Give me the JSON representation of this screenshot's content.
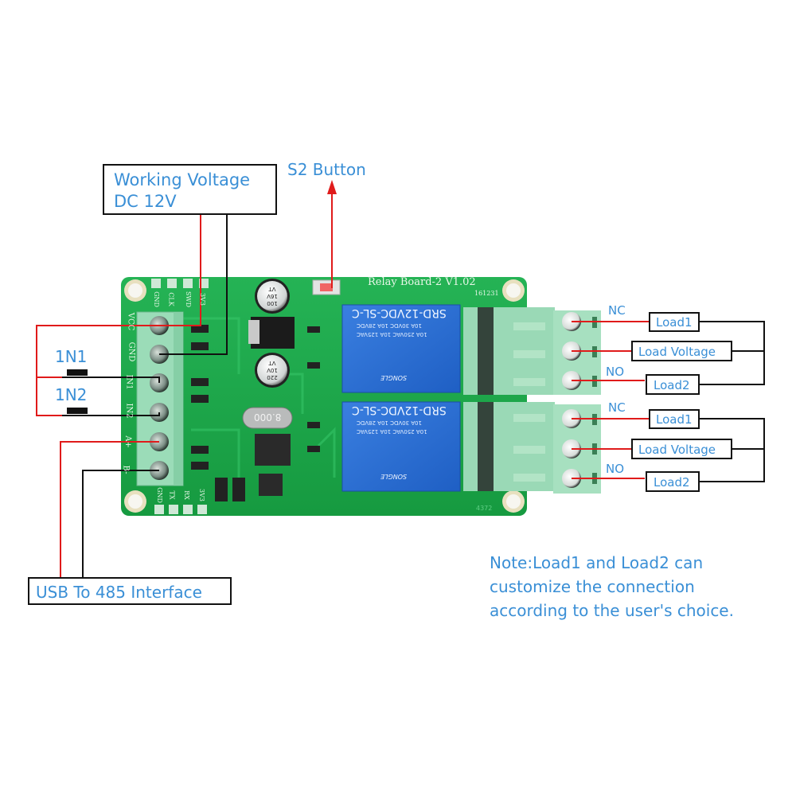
{
  "diagram": {
    "title_box": {
      "line1": "Working Voltage",
      "line2": "DC 12V"
    },
    "s2_label": "S2 Button",
    "inputs": {
      "in1": "1N1",
      "in2": "1N2"
    },
    "usb_box": "USB To 485 Interface",
    "relay_outputs": [
      {
        "nc": "NC",
        "no": "NO",
        "load1": "Load1",
        "load_voltage": "Load Voltage",
        "load2": "Load2"
      },
      {
        "nc": "NC",
        "no": "NO",
        "load1": "Load1",
        "load_voltage": "Load Voltage",
        "load2": "Load2"
      }
    ],
    "note": {
      "line1": "Note:Load1 and Load2 can",
      "line2": "customize the connection",
      "line3": "according to the user's choice."
    }
  },
  "board": {
    "name": "Relay Board-2  V1.02",
    "date_code": "161231",
    "terminal_pins": [
      "VCC",
      "GND",
      "IN1",
      "IN2",
      "A+",
      "B-"
    ],
    "top_header_pins": [
      "GND",
      "CLK",
      "SWD",
      "3V3"
    ],
    "bottom_header_pins": [
      "GND",
      "TX",
      "RX",
      "3V3"
    ],
    "crystal": "8.000",
    "cap1": [
      "100",
      "16V",
      "VT"
    ],
    "cap2": [
      "220",
      "10V",
      "VT"
    ],
    "relay": {
      "model": "SRD-12VDC-SL-C",
      "rating1": "10A 250VAC  10A 125VAC",
      "rating2": "10A 30VDC  10A 28VDC",
      "brand": "SONGLE"
    },
    "serial": "4372"
  },
  "colors": {
    "label_blue": "#3a8fd6",
    "wire_red": "#e01b1b",
    "wire_black": "#111111",
    "pcb_green": "#1fa84a",
    "relay_blue": "#2a6fd0",
    "terminal_green": "#8fd6ad"
  }
}
